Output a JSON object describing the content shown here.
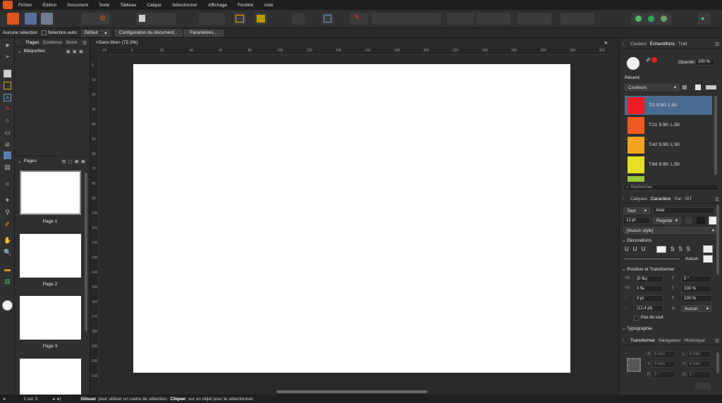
{
  "menu": [
    "Fichier",
    "Édition",
    "Document",
    "Texte",
    "Tableau",
    "Calque",
    "Sélectionner",
    "Affichage",
    "Fenêtre",
    "Aide"
  ],
  "context_bar": {
    "selection_status": "Aucune sélection",
    "checkbox_label": "Sélection auto:",
    "default_select": "Défaut",
    "doc_setup_button": "Configuration du document...",
    "settings_button": "Paramètres..."
  },
  "left_panel": {
    "tabs": [
      "Pages",
      "Contenus",
      "Stock"
    ],
    "masters_label": "Maquettes",
    "pages_label": "Pages",
    "pages": [
      "Page 1",
      "Page 2",
      "Page 3"
    ]
  },
  "document": {
    "tab_title": "<Sans titre> (72,3%)",
    "h_ruler": [
      "-20",
      "0",
      "20",
      "40",
      "60",
      "80",
      "100",
      "120",
      "140",
      "160",
      "180",
      "200",
      "220",
      "240",
      "260",
      "280",
      "300",
      "320"
    ],
    "v_ruler": [
      "0",
      "10",
      "20",
      "30",
      "40",
      "50",
      "60",
      "70",
      "80",
      "90",
      "100",
      "110",
      "120",
      "130",
      "140",
      "150",
      "160",
      "170",
      "180",
      "190",
      "200",
      "210"
    ]
  },
  "status_bar": {
    "page_indicator": "1 sur 3",
    "hint_bold_1": "Glisser",
    "hint_1": "pour utiliser un cadre de sélection.",
    "hint_bold_2": "Cliquer",
    "hint_2": "sur un objet pour le sélectionner."
  },
  "right_panel": {
    "top_tabs": [
      "Couleur",
      "Échantillons",
      "Trait"
    ],
    "opacity_label": "Opacité:",
    "opacity_value": "100 %",
    "recent_label": "Récent:",
    "palette_select": "Couleurs",
    "swatches": [
      {
        "label": "T:0 S:90: L:50",
        "color": "#ee1c24"
      },
      {
        "label": "T:21 S:90: L:50",
        "color": "#ef5a22"
      },
      {
        "label": "T:42 S:90: L:50",
        "color": "#f2a21c"
      },
      {
        "label": "T:64 S:90: L:50",
        "color": "#e2e020"
      }
    ],
    "search_placeholder": "Rechercher",
    "char_tabs": [
      "Calques",
      "Caractère",
      "Par",
      "SIT"
    ],
    "font_scope": "Tout",
    "font_family": "Arial",
    "font_size": "12 pt",
    "font_style": "Regular",
    "style_select": "[Aucun style]",
    "decorations_label": "Décorations",
    "decoration_none": "Aucun",
    "pos_transform_label": "Position et Transformer",
    "tracking": "(0 ‰)",
    "baseline": "0 ‰",
    "kerning": "0 pt",
    "leading": "(12,4 pt)",
    "rotation": "0 °",
    "h_scale": "100 %",
    "v_scale": "100 %",
    "hyphenation": "Aucun",
    "no_break_label": "Pas de saut",
    "typography_label": "Typographie",
    "bottom_tabs": [
      "Transformer",
      "Navigateur",
      "Historique"
    ],
    "transform": {
      "x": "0 mm",
      "y": "0 mm",
      "w": "0 mm",
      "h": "0 mm",
      "r": "0 °",
      "s": "0 °"
    }
  },
  "colors": {
    "accent": "#4a90d9",
    "selected_swatch_bg": "#4b6a8f",
    "canvas": "#2a2a2a",
    "menubar": "#1e1e1e"
  }
}
